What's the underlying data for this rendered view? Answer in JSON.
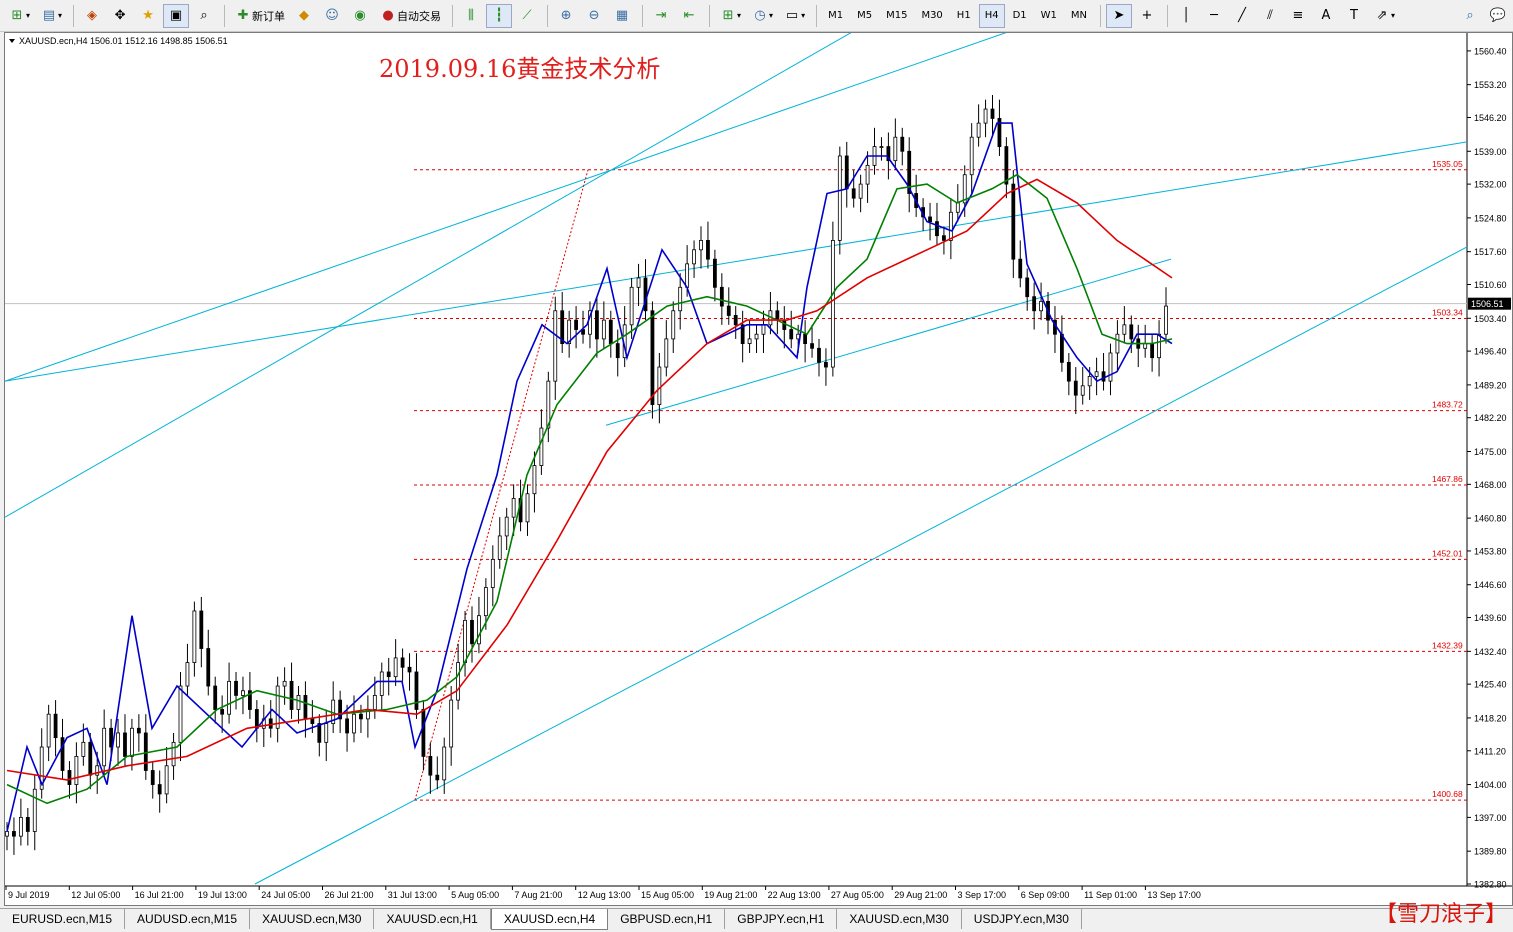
{
  "toolbar": {
    "new_order_label": "新订单",
    "auto_trade_label": "自动交易",
    "timeframes": [
      "M1",
      "M5",
      "M15",
      "M30",
      "H1",
      "H4",
      "D1",
      "W1",
      "MN"
    ],
    "active_timeframe": "H4",
    "text_tool_label": "A"
  },
  "chart": {
    "symbol_info": "XAUUSD.ecn,H4  1506.01 1512.16 1498.85 1506.51",
    "title": "2019.09.16黄金技术分析",
    "current_price": "1506.51",
    "colors": {
      "title": "#e0201c",
      "candle": "#000000",
      "ma_fast": "#0000cc",
      "ma_mid": "#008000",
      "ma_slow": "#e00000",
      "trend_line": "#00b4d8",
      "level_line": "#e00000"
    }
  },
  "chart_data": {
    "type": "candlestick",
    "symbol": "XAUUSD.ecn",
    "timeframe": "H4",
    "ylim": [
      1382.8,
      1564
    ],
    "y_ticks": [
      "1560.40",
      "1553.20",
      "1546.20",
      "1539.00",
      "1532.00",
      "1524.80",
      "1517.60",
      "1510.60",
      "1503.40",
      "1496.40",
      "1489.20",
      "1482.20",
      "1475.00",
      "1468.00",
      "1460.80",
      "1453.80",
      "1446.60",
      "1439.60",
      "1432.40",
      "1425.40",
      "1418.20",
      "1411.20",
      "1404.00",
      "1397.00",
      "1389.80",
      "1382.80"
    ],
    "x_ticks": [
      "9 Jul 2019",
      "12 Jul 05:00",
      "16 Jul 21:00",
      "19 Jul 13:00",
      "24 Jul 05:00",
      "26 Jul 21:00",
      "31 Jul 13:00",
      "5 Aug 05:00",
      "7 Aug 21:00",
      "12 Aug 13:00",
      "15 Aug 05:00",
      "19 Aug 21:00",
      "22 Aug 13:00",
      "27 Aug 05:00",
      "29 Aug 21:00",
      "3 Sep 17:00",
      "6 Sep 09:00",
      "11 Sep 01:00",
      "13 Sep 17:00"
    ],
    "levels": [
      {
        "value": 1535.05,
        "label": "1535.05"
      },
      {
        "value": 1503.34,
        "label": "1503.34"
      },
      {
        "value": 1483.72,
        "label": "1483.72"
      },
      {
        "value": 1467.86,
        "label": "1467.86"
      },
      {
        "value": 1452.01,
        "label": "1452.01"
      },
      {
        "value": 1432.39,
        "label": "1432.39"
      },
      {
        "value": 1400.68,
        "label": "1400.68"
      }
    ],
    "last_price": 1506.51,
    "closes": [
      1394,
      1393,
      1397,
      1394,
      1403,
      1412,
      1419,
      1414,
      1407,
      1404,
      1410,
      1413,
      1406,
      1408,
      1416,
      1412,
      1415,
      1410,
      1416,
      1415,
      1407,
      1404,
      1402,
      1408,
      1413,
      1425,
      1430,
      1441,
      1433,
      1425,
      1420,
      1419,
      1426,
      1423,
      1424,
      1420,
      1416,
      1418,
      1416,
      1425,
      1426,
      1420,
      1423,
      1418,
      1417,
      1413,
      1417,
      1422,
      1418,
      1415,
      1419,
      1418,
      1420,
      1423,
      1428,
      1427,
      1431,
      1429,
      1428,
      1420,
      1410,
      1406,
      1405,
      1412,
      1422,
      1430,
      1439,
      1434,
      1440,
      1446,
      1452,
      1457,
      1461,
      1465,
      1460,
      1466,
      1472,
      1480,
      1490,
      1505,
      1498,
      1503,
      1501,
      1500,
      1505,
      1499,
      1503,
      1498,
      1495,
      1502,
      1510,
      1512,
      1505,
      1485,
      1493,
      1499,
      1505,
      1510,
      1515,
      1518,
      1520,
      1516,
      1510,
      1506,
      1504,
      1502,
      1498,
      1499,
      1500,
      1502,
      1505,
      1503,
      1501,
      1499,
      1500,
      1498,
      1497,
      1494,
      1493,
      1520,
      1538,
      1531,
      1529,
      1532,
      1536,
      1540,
      1540,
      1537,
      1542,
      1539,
      1530,
      1527,
      1525,
      1524,
      1521,
      1520,
      1526,
      1528,
      1534,
      1542,
      1545,
      1548,
      1546,
      1540,
      1532,
      1516,
      1512,
      1508,
      1505,
      1507,
      1503,
      1500,
      1494,
      1490,
      1487,
      1489,
      1491,
      1492,
      1490,
      1496,
      1500,
      1502,
      1499,
      1497,
      1498,
      1495,
      1500,
      1506
    ],
    "series": [
      {
        "name": "MA-fast",
        "points": [
          [
            0,
            1394
          ],
          [
            20,
            1412
          ],
          [
            35,
            1404
          ],
          [
            60,
            1414
          ],
          [
            80,
            1416
          ],
          [
            100,
            1404
          ],
          [
            125,
            1440
          ],
          [
            145,
            1416
          ],
          [
            170,
            1425
          ],
          [
            205,
            1418
          ],
          [
            235,
            1412
          ],
          [
            265,
            1420
          ],
          [
            290,
            1415
          ],
          [
            330,
            1418
          ],
          [
            370,
            1426
          ],
          [
            395,
            1426
          ],
          [
            408,
            1412
          ],
          [
            430,
            1424
          ],
          [
            460,
            1450
          ],
          [
            490,
            1470
          ],
          [
            510,
            1490
          ],
          [
            535,
            1502
          ],
          [
            560,
            1498
          ],
          [
            580,
            1502
          ],
          [
            600,
            1514
          ],
          [
            620,
            1495
          ],
          [
            655,
            1518
          ],
          [
            680,
            1510
          ],
          [
            700,
            1498
          ],
          [
            740,
            1502
          ],
          [
            760,
            1502
          ],
          [
            790,
            1495
          ],
          [
            800,
            1510
          ],
          [
            820,
            1530
          ],
          [
            840,
            1531
          ],
          [
            860,
            1538
          ],
          [
            880,
            1538
          ],
          [
            900,
            1532
          ],
          [
            920,
            1524
          ],
          [
            945,
            1522
          ],
          [
            965,
            1530
          ],
          [
            990,
            1545
          ],
          [
            1005,
            1545
          ],
          [
            1020,
            1515
          ],
          [
            1045,
            1503
          ],
          [
            1070,
            1495
          ],
          [
            1090,
            1490
          ],
          [
            1110,
            1492
          ],
          [
            1130,
            1500
          ],
          [
            1150,
            1500
          ],
          [
            1165,
            1498
          ]
        ]
      },
      {
        "name": "MA-mid",
        "points": [
          [
            0,
            1404
          ],
          [
            40,
            1400
          ],
          [
            80,
            1403
          ],
          [
            120,
            1410
          ],
          [
            170,
            1412
          ],
          [
            210,
            1420
          ],
          [
            250,
            1424
          ],
          [
            290,
            1422
          ],
          [
            330,
            1419
          ],
          [
            380,
            1420
          ],
          [
            420,
            1422
          ],
          [
            450,
            1427
          ],
          [
            490,
            1443
          ],
          [
            520,
            1470
          ],
          [
            550,
            1485
          ],
          [
            590,
            1496
          ],
          [
            620,
            1500
          ],
          [
            660,
            1506
          ],
          [
            700,
            1508
          ],
          [
            740,
            1506
          ],
          [
            780,
            1502
          ],
          [
            800,
            1500
          ],
          [
            830,
            1510
          ],
          [
            860,
            1516
          ],
          [
            890,
            1531
          ],
          [
            920,
            1532
          ],
          [
            950,
            1528
          ],
          [
            985,
            1531
          ],
          [
            1010,
            1534
          ],
          [
            1040,
            1529
          ],
          [
            1070,
            1514
          ],
          [
            1095,
            1500
          ],
          [
            1120,
            1498
          ],
          [
            1145,
            1498
          ],
          [
            1165,
            1499
          ]
        ]
      },
      {
        "name": "MA-slow",
        "points": [
          [
            0,
            1407
          ],
          [
            60,
            1405
          ],
          [
            120,
            1408
          ],
          [
            180,
            1410
          ],
          [
            240,
            1416
          ],
          [
            300,
            1418
          ],
          [
            360,
            1420
          ],
          [
            410,
            1419
          ],
          [
            450,
            1424
          ],
          [
            500,
            1438
          ],
          [
            550,
            1456
          ],
          [
            600,
            1475
          ],
          [
            650,
            1488
          ],
          [
            700,
            1498
          ],
          [
            740,
            1503
          ],
          [
            780,
            1503
          ],
          [
            810,
            1505
          ],
          [
            860,
            1512
          ],
          [
            920,
            1518
          ],
          [
            960,
            1522
          ],
          [
            1000,
            1530
          ],
          [
            1030,
            1533
          ],
          [
            1070,
            1528
          ],
          [
            1110,
            1520
          ],
          [
            1165,
            1512
          ]
        ]
      }
    ]
  },
  "tabs": [
    {
      "label": "EURUSD.ecn,M15",
      "active": false
    },
    {
      "label": "AUDUSD.ecn,M15",
      "active": false
    },
    {
      "label": "XAUUSD.ecn,M30",
      "active": false
    },
    {
      "label": "XAUUSD.ecn,H1",
      "active": false
    },
    {
      "label": "XAUUSD.ecn,H4",
      "active": true
    },
    {
      "label": "GBPUSD.ecn,H1",
      "active": false
    },
    {
      "label": "GBPJPY.ecn,H1",
      "active": false
    },
    {
      "label": "XAUUSD.ecn,M30",
      "active": false
    },
    {
      "label": "USDJPY.ecn,M30",
      "active": false
    }
  ],
  "watermark": "【雪刀浪子】"
}
